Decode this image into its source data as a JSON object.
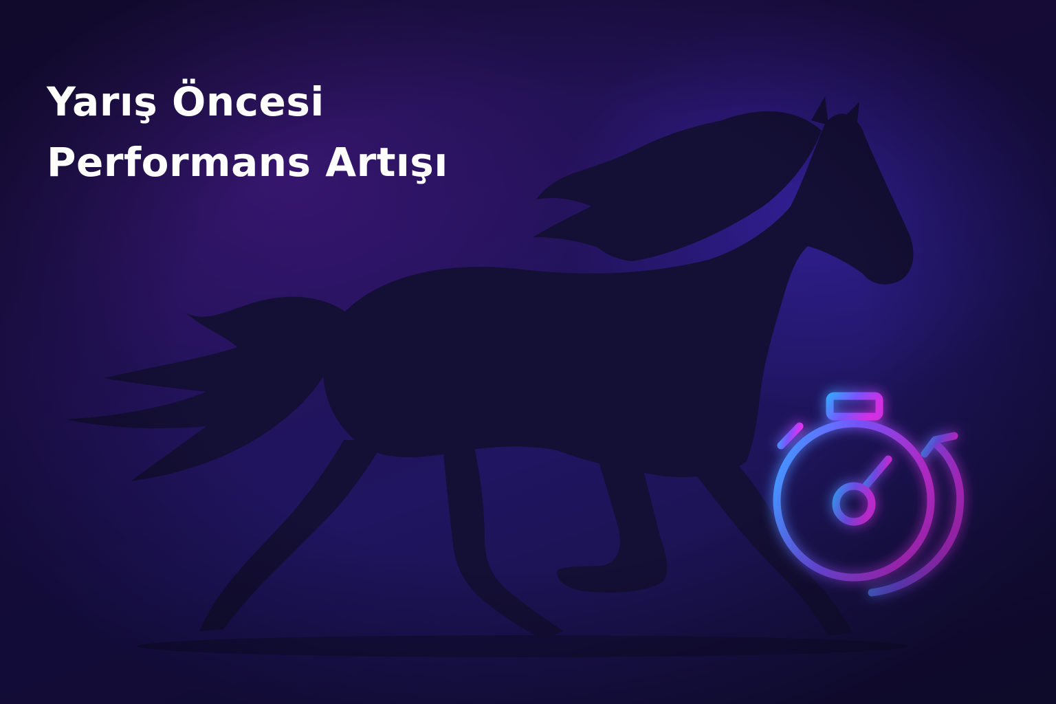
{
  "headline": {
    "line1": "Yarış Öncesi",
    "line2": "Performans Artışı"
  },
  "illustration": {
    "subject": "horse-silhouette-icon",
    "badge": "stopwatch-refresh-icon"
  },
  "colors": {
    "background_dark": "#1a1040",
    "background_glow": "#3b28be",
    "horse_silhouette": "#140f35",
    "text": "#ffffff",
    "stopwatch_gradient_start": "#3aa0ff",
    "stopwatch_gradient_mid": "#7a55ff",
    "stopwatch_gradient_end": "#e030f0"
  }
}
